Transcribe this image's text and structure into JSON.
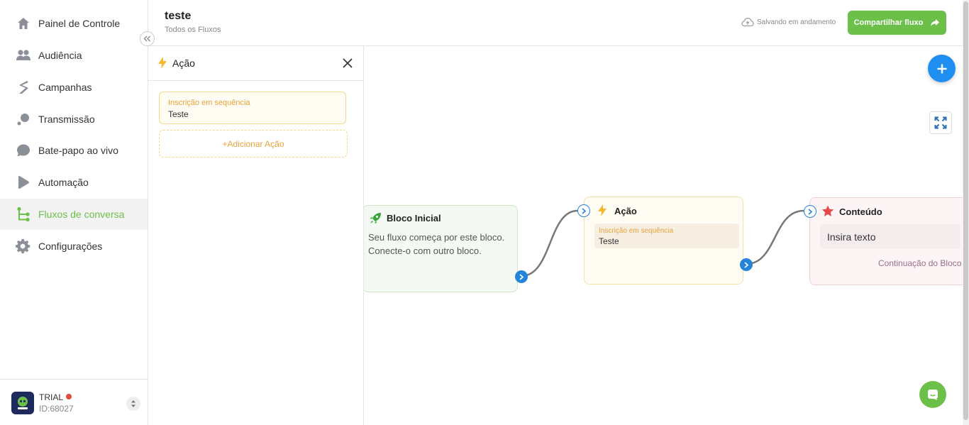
{
  "sidebar": {
    "items": [
      {
        "label": "Painel de Controle",
        "icon": "home-icon"
      },
      {
        "label": "Audiência",
        "icon": "users-icon"
      },
      {
        "label": "Campanhas",
        "icon": "campaign-icon"
      },
      {
        "label": "Transmissão",
        "icon": "broadcast-icon"
      },
      {
        "label": "Bate-papo ao vivo",
        "icon": "chat-icon"
      },
      {
        "label": "Automação",
        "icon": "automation-icon"
      },
      {
        "label": "Fluxos de conversa",
        "icon": "flow-icon",
        "active": true
      },
      {
        "label": "Configurações",
        "icon": "gear-icon"
      }
    ],
    "account": {
      "plan": "TRIAL",
      "id": "ID:68027"
    }
  },
  "header": {
    "title": "teste",
    "breadcrumb": "Todos os Fluxos",
    "save_status": "Salvando em andamento",
    "share_label": "Compartilhar fluxo"
  },
  "panel": {
    "title": "Ação",
    "action_label": "Inscrição em sequência",
    "action_value": "Teste",
    "add_action_label": "+Adicionar Ação"
  },
  "canvas": {
    "start_node": {
      "title": "Bloco Inicial",
      "text": "Seu fluxo começa por este bloco. Conecte-o com outro bloco."
    },
    "action_node": {
      "title": "Ação",
      "field_label": "Inscrição em sequência",
      "field_value": "Teste"
    },
    "content_node": {
      "title": "Conteúdo",
      "input_text": "Insira texto",
      "continuation_label": "Continuação do Bloco"
    }
  },
  "colors": {
    "brand_green": "#6cc04a",
    "accent_blue": "#1f8ef1",
    "action_orange": "#e8a33c",
    "danger_red": "#e04b3c"
  }
}
